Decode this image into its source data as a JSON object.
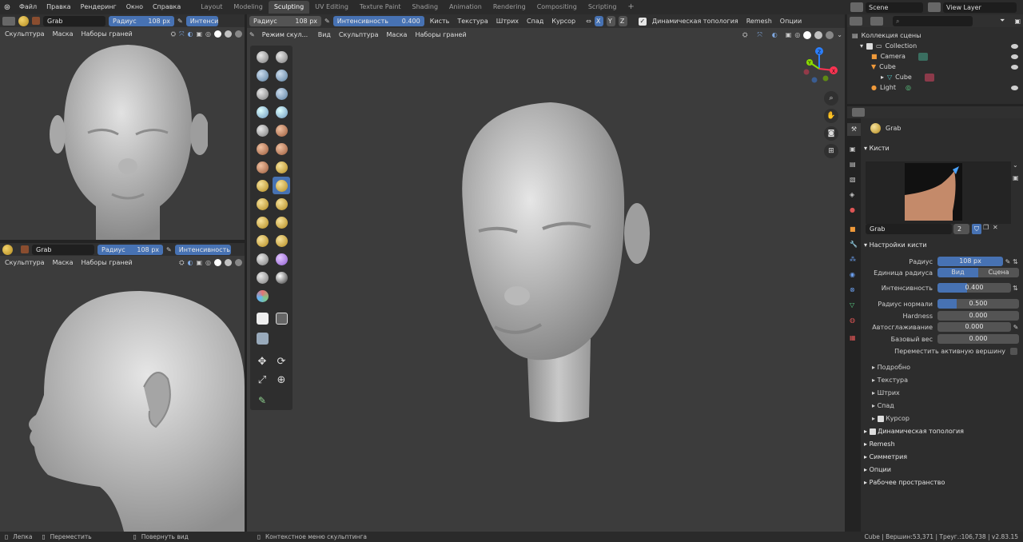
{
  "topbar": {
    "menus": [
      "Файл",
      "Правка",
      "Рендеринг",
      "Окно",
      "Справка"
    ],
    "workspaces": [
      "Layout",
      "Modeling",
      "Sculpting",
      "UV Editing",
      "Texture Paint",
      "Shading",
      "Animation",
      "Rendering",
      "Compositing",
      "Scripting"
    ],
    "active_workspace": "Sculpting",
    "add_tab": "+",
    "scene": "Scene",
    "view_layer": "View Layer"
  },
  "left_top_view": {
    "brush_name": "Grab",
    "radius_label": "Радиус",
    "radius_value": "108 px",
    "intensity_label": "Интенси",
    "menus": [
      "Скульптура",
      "Маска",
      "Наборы граней"
    ]
  },
  "left_bottom_view": {
    "brush_name": "Grab",
    "radius_label": "Радиус",
    "radius_value": "108 px",
    "intensity_label": "Интенсивность",
    "menus": [
      "Скульптура",
      "Маска",
      "Наборы граней"
    ]
  },
  "main_view": {
    "radius_label": "Радиус",
    "radius_value": "108 px",
    "intensity_label": "Интенсивность",
    "intensity_value": "0.400",
    "header_menus": [
      "Кисть",
      "Текстура",
      "Штрих",
      "Спад",
      "Курсор"
    ],
    "axes": [
      "X",
      "Y",
      "Z"
    ],
    "dyntopo_label": "Динамическая топология",
    "remesh_label": "Remesh",
    "options_label": "Опции",
    "mode": "Режим скул...",
    "view_menus": [
      "Вид",
      "Скульптура",
      "Маска",
      "Наборы граней"
    ],
    "gizmo_axes": [
      "X",
      "Y",
      "Z"
    ]
  },
  "outliner": {
    "search_placeholder": "",
    "root": "Коллекция сцены",
    "items": [
      {
        "name": "Collection",
        "depth": 1
      },
      {
        "name": "Camera",
        "depth": 2
      },
      {
        "name": "Cube",
        "depth": 2
      },
      {
        "name": "Cube",
        "depth": 3
      },
      {
        "name": "Light",
        "depth": 2
      }
    ]
  },
  "properties": {
    "brush_name": "Grab",
    "brushes_section": "Кисти",
    "brush_field": "Grab",
    "brush_users": "2",
    "settings_section": "Настройки кисти",
    "rows": [
      {
        "label": "Радиус",
        "value": "108 px",
        "fill": 0.0
      },
      {
        "label": "Интенсивность",
        "value": "0.400",
        "fill": 0.4
      },
      {
        "label": "Радиус нормали",
        "value": "0.500",
        "fill": 0.5
      },
      {
        "label": "Hardness",
        "value": "0.000",
        "fill": 0.0
      },
      {
        "label": "Автосглаживание",
        "value": "0.000",
        "fill": 0.0
      },
      {
        "label": "Базовый вес",
        "value": "0.000",
        "fill": 0.0
      }
    ],
    "radius_unit_label": "Единица радиуса",
    "radius_unit_options": [
      "Вид",
      "Сцена"
    ],
    "radius_unit_selected": "Вид",
    "move_active_vertex": "Переместить активную вершину",
    "subpanels": [
      "Подробно",
      "Текстура",
      "Штрих",
      "Спад",
      "Курсор"
    ],
    "panels": [
      "Динамическая топология",
      "Remesh",
      "Симметрия",
      "Опции",
      "Рабочее пространство"
    ]
  },
  "statusbar": {
    "items": [
      "Лепка",
      "Переместить",
      "Повернуть вид",
      "Контекстное меню скульптинга"
    ],
    "stats": "Cube | Вершин:53,371 | Треуг.:106,738 | v2.83.15"
  },
  "colors": {
    "accent": "#4772b3",
    "viewport": "#3c3c3c",
    "header": "#303030",
    "panel": "#2d2d2d"
  }
}
